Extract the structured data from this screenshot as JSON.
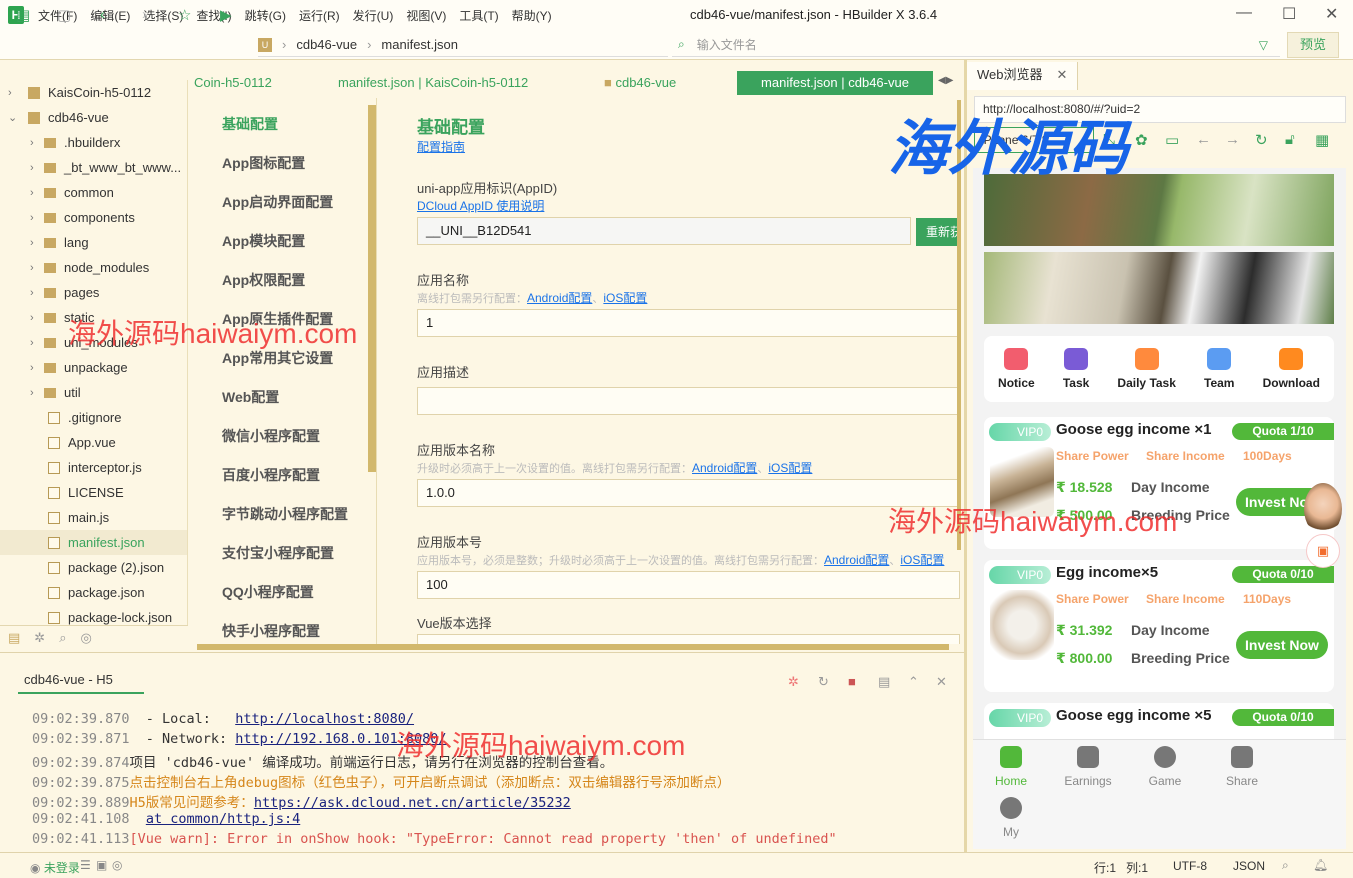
{
  "window": {
    "title": "cdb46-vue/manifest.json - HBuilder X 3.6.4",
    "logo": "H"
  },
  "menu": [
    "文件(F)",
    "编辑(E)",
    "选择(S)",
    "查找(I)",
    "跳转(G)",
    "运行(R)",
    "发行(U)",
    "视图(V)",
    "工具(T)",
    "帮助(Y)"
  ],
  "toolbar": {
    "breadcrumb": [
      "cdb46-vue",
      "manifest.json"
    ],
    "file_search_placeholder": "输入文件名",
    "preview": "预览"
  },
  "sidebar": {
    "items": [
      {
        "label": "KaisCoin-h5-0112",
        "type": "project",
        "arrow": "›"
      },
      {
        "label": "cdb46-vue",
        "type": "project",
        "arrow": "⌄"
      },
      {
        "label": ".hbuilderx",
        "type": "folder",
        "arrow": "›"
      },
      {
        "label": "_bt_www_bt_www...",
        "type": "folder",
        "arrow": "›"
      },
      {
        "label": "common",
        "type": "folder",
        "arrow": "›"
      },
      {
        "label": "components",
        "type": "folder",
        "arrow": "›"
      },
      {
        "label": "lang",
        "type": "folder",
        "arrow": "›"
      },
      {
        "label": "node_modules",
        "type": "folder",
        "arrow": "›"
      },
      {
        "label": "pages",
        "type": "folder",
        "arrow": "›"
      },
      {
        "label": "static",
        "type": "folder",
        "arrow": "›"
      },
      {
        "label": "uni_modules",
        "type": "folder",
        "arrow": "›"
      },
      {
        "label": "unpackage",
        "type": "folder",
        "arrow": "›"
      },
      {
        "label": "util",
        "type": "folder",
        "arrow": "›"
      },
      {
        "label": ".gitignore",
        "type": "file"
      },
      {
        "label": "App.vue",
        "type": "file"
      },
      {
        "label": "interceptor.js",
        "type": "file"
      },
      {
        "label": "LICENSE",
        "type": "file"
      },
      {
        "label": "main.js",
        "type": "file"
      },
      {
        "label": "manifest.json",
        "type": "file",
        "selected": true
      },
      {
        "label": "package (2).json",
        "type": "file"
      },
      {
        "label": "package.json",
        "type": "file"
      },
      {
        "label": "package-lock.json",
        "type": "file"
      }
    ]
  },
  "editor_tabs": [
    "Coin-h5-0112",
    "manifest.json | KaisCoin-h5-0112",
    "cdb46-vue",
    "manifest.json | cdb46-vue"
  ],
  "settings_nav": [
    "基础配置",
    "App图标配置",
    "App启动界面配置",
    "App模块配置",
    "App权限配置",
    "App原生插件配置",
    "App常用其它设置",
    "Web配置",
    "微信小程序配置",
    "百度小程序配置",
    "字节跳动小程序配置",
    "支付宝小程序配置",
    "QQ小程序配置",
    "快手小程序配置"
  ],
  "form": {
    "title": "基础配置",
    "guide": "配置指南",
    "appid_label": "uni-app应用标识(AppID)",
    "appid_help": "DCloud AppID 使用说明",
    "appid_value": "__UNI__B12D541",
    "renew": "重新获取",
    "name_label": "应用名称",
    "name_hint": "离线打包需另行配置：",
    "name_value": "1",
    "desc_label": "应用描述",
    "desc_value": "",
    "vname_label": "应用版本名称",
    "vname_hint": "升级时必须高于上一次设置的值。离线打包需另行配置：",
    "vname_value": "1.0.0",
    "vcode_label": "应用版本号",
    "vcode_hint": "应用版本号，必须是整数；升级时必须高于上一次设置的值。离线打包需另行配置：",
    "vcode_value": "100",
    "vue_label": "Vue版本选择",
    "android_link": "Android配置",
    "ios_link": "iOS配置",
    "sep": "、"
  },
  "browser": {
    "tab": "Web浏览器",
    "url": "http://localhost:8080/#/?uid=2",
    "device": "iPhone 6/7/8"
  },
  "phone": {
    "quick": [
      {
        "label": "Notice",
        "color": "#f25d6e"
      },
      {
        "label": "Task",
        "color": "#7a5bd6"
      },
      {
        "label": "Daily Task",
        "color": "#ff8a3d"
      },
      {
        "label": "Team",
        "color": "#5b9cf2"
      },
      {
        "label": "Download",
        "color": "#ff8a1f"
      }
    ],
    "cards": [
      {
        "vip": "VIP0",
        "title": "Goose egg income ×1",
        "quota": "Quota 1/10",
        "share_power": "Share Power",
        "share_income": "Share Income",
        "days": "100Days",
        "day_income": "₹ 18.528",
        "day_income_label": "Day Income",
        "price": "₹ 500.00",
        "price_label": "Breeding Price",
        "button": "Invest Now"
      },
      {
        "vip": "VIP0",
        "title": "Egg income×5",
        "quota": "Quota 0/10",
        "share_power": "Share Power",
        "share_income": "Share Income",
        "days": "110Days",
        "day_income": "₹ 31.392",
        "day_income_label": "Day Income",
        "price": "₹ 800.00",
        "price_label": "Breeding Price",
        "button": "Invest Now"
      },
      {
        "vip": "VIP0",
        "title": "Goose egg income ×5",
        "quota": "Quota 0/10"
      }
    ],
    "tabbar": [
      "Home",
      "Earnings",
      "Game",
      "Share",
      "My"
    ]
  },
  "console": {
    "tab": "cdb46-vue - H5",
    "lines": [
      {
        "time": "09:02:39.870",
        "text": "  - Local:   ",
        "link": "http://localhost:8080/",
        "kind": "normal"
      },
      {
        "time": "09:02:39.871",
        "text": "  - Network: ",
        "link": "http://192.168.0.101:8080/",
        "kind": "normal"
      },
      {
        "time": "09:02:39.874",
        "text": "项目 'cdb46-vue' 编译成功。前端运行日志，请另行在浏览器的控制台查看。",
        "kind": "normal"
      },
      {
        "time": "09:02:39.875",
        "text": "点击控制台右上角debug图标（红色虫子），可开启断点调试（添加断点：双击编辑器行号添加断点）",
        "kind": "warn"
      },
      {
        "time": "09:02:39.889",
        "text": "H5版常见问题参考：",
        "link": "https://ask.dcloud.net.cn/article/35232",
        "kind": "warn"
      },
      {
        "time": "09:02:41.108",
        "text": "  ",
        "link": "at common/http.js:4",
        "kind": "normal"
      },
      {
        "time": "09:02:41.113",
        "text": "[Vue warn]: Error in onShow hook: \"TypeError: Cannot read property 'then' of undefined\"",
        "kind": "err"
      }
    ]
  },
  "status": {
    "login": "未登录",
    "line": "行:1",
    "col": "列:1",
    "encoding": "UTF-8",
    "lang": "JSON"
  },
  "watermarks": {
    "red": "海外源码haiwaiym.com",
    "blue": "海外源码"
  },
  "colors": {
    "accent": "#3aa35d",
    "phone_green": "#52b83a",
    "background": "#fdf7e4"
  }
}
